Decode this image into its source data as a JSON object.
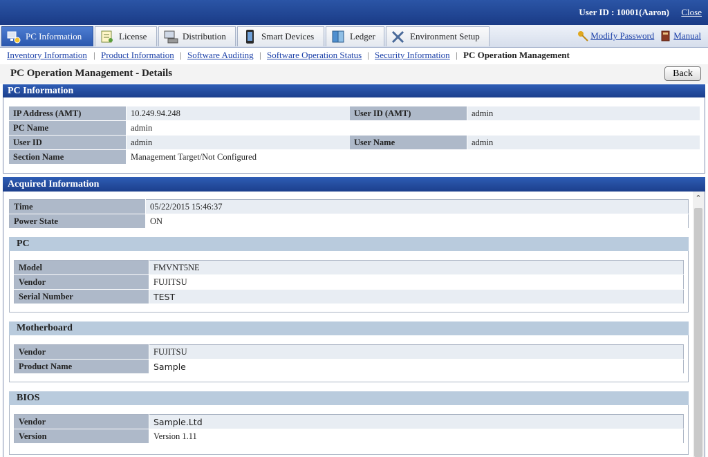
{
  "header": {
    "user_label": "User ID : 10001(Aaron)",
    "close_label": "Close"
  },
  "tabs": [
    {
      "label": "PC Information",
      "icon": "pc-info-icon"
    },
    {
      "label": "License",
      "icon": "license-icon"
    },
    {
      "label": "Distribution",
      "icon": "distribution-icon"
    },
    {
      "label": "Smart Devices",
      "icon": "smart-device-icon"
    },
    {
      "label": "Ledger",
      "icon": "ledger-icon"
    },
    {
      "label": "Environment Setup",
      "icon": "environment-setup-icon"
    }
  ],
  "right_links": {
    "modify_password": "Modify Password",
    "manual": "Manual"
  },
  "sub_nav": {
    "items": [
      "Inventory Information",
      "Product Information",
      "Software Auditing",
      "Software Operation Status",
      "Security Information"
    ],
    "current": "PC Operation Management"
  },
  "page": {
    "title": "PC Operation Management - Details",
    "back_label": "Back"
  },
  "pc_information": {
    "title": "PC Information",
    "ip_label": "IP Address (AMT)",
    "ip_value": "10.249.94.248",
    "uid_amt_label": "User ID (AMT)",
    "uid_amt_value": "admin",
    "pc_name_label": "PC Name",
    "pc_name_value": "admin",
    "user_id_label": "User ID",
    "user_id_value": "admin",
    "user_name_label": "User Name",
    "user_name_value": "admin",
    "section_label": "Section Name",
    "section_value": "Management Target/Not Configured"
  },
  "acquired": {
    "title": "Acquired Information",
    "time_label": "Time",
    "time_value": "05/22/2015 15:46:37",
    "power_label": "Power State",
    "power_value": "ON",
    "pc": {
      "title": "PC",
      "rows": [
        {
          "label": "Model",
          "value": "FMVNT5NE"
        },
        {
          "label": "Vendor",
          "value": "FUJITSU"
        },
        {
          "label": "Serial Number",
          "value": "TEST"
        }
      ]
    },
    "motherboard": {
      "title": "Motherboard",
      "rows": [
        {
          "label": "Vendor",
          "value": "FUJITSU"
        },
        {
          "label": "Product Name",
          "value": "Sample"
        }
      ]
    },
    "bios": {
      "title": "BIOS",
      "rows": [
        {
          "label": "Vendor",
          "value": "Sample.Ltd"
        },
        {
          "label": "Version",
          "value": "Version 1.11"
        }
      ]
    }
  }
}
